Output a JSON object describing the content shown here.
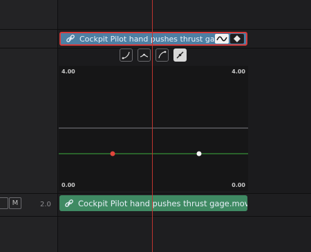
{
  "clip_top": {
    "name": "Cockpit Pilot hand pushes thrust gag..."
  },
  "clip_bottom": {
    "name": "Cockpit Pilot hand pushes thrust gage.mov"
  },
  "graph": {
    "y_max_left": "4.00",
    "y_max_right": "4.00",
    "y_min_left": "0.00",
    "y_min_right": "0.00"
  },
  "track": {
    "mute_label": "M",
    "audio_level": "2.0"
  },
  "curve_tools": [
    "ease-in",
    "ease-out-point",
    "ease-out",
    "linear"
  ],
  "colors": {
    "clip_video": "#4d7fa3",
    "clip_audio": "#3f8a63",
    "selection": "#d63b3b",
    "playhead": "#c0352f",
    "curve": "#3fae3f"
  }
}
